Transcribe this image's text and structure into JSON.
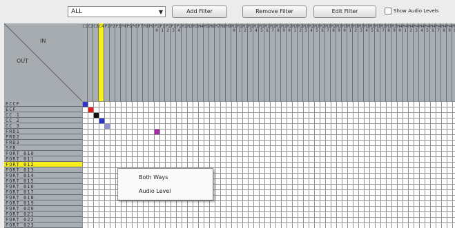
{
  "toolbar": {
    "filter": {
      "selected": "ALL"
    },
    "add_filter": "Add Filter",
    "remove_filter": "Remove Filter",
    "edit_filter": "Edit Filter",
    "show_audio_levels": {
      "label": "Show Audio Levels",
      "checked": false
    }
  },
  "corner": {
    "in_label": "IN",
    "out_label": "OUT"
  },
  "columns": [
    "C1",
    "C2",
    "C3",
    "C4",
    "P1",
    "P2",
    "P3",
    "P4",
    "P5",
    "P6",
    "P7",
    "P8",
    "P9",
    "P10",
    "P11",
    "P12",
    "P13",
    "P14",
    "M1",
    "M2",
    "M3",
    "M4",
    "M5",
    "M6",
    "M7",
    "M8",
    "M9",
    "M10",
    "M11",
    "M12",
    "M13",
    "M14",
    "M15",
    "M16",
    "M17",
    "M18",
    "M19",
    "M20",
    "M21",
    "M22",
    "M23",
    "M24",
    "M25",
    "M26",
    "M27",
    "M28",
    "M29",
    "M30",
    "M31",
    "M32",
    "M33",
    "M34",
    "M35",
    "M36",
    "M37",
    "M38",
    "M39",
    "M40",
    "M41",
    "M42",
    "M43",
    "M44",
    "M45",
    "M46",
    "M47",
    "M48",
    "M49",
    "M50",
    "M51",
    "M52"
  ],
  "selected_column_index": 3,
  "rows": [
    "ECCF",
    "ECF",
    "CC 1",
    "CC 2",
    "CC 3",
    "FRD1",
    "FRD2",
    "FRD3",
    "SFR",
    "FORT_010",
    "FORT_011",
    "FORT_012",
    "FORT_013",
    "FORT_014",
    "FORT_015",
    "FORT_016",
    "FORT_017",
    "FORT_018",
    "FORT_019",
    "FORT_020",
    "FORT_021",
    "FORT_022",
    "FORT_023"
  ],
  "selected_row_index": 11,
  "crosspoints": [
    {
      "row": 0,
      "col": 0,
      "color": "#2b35c9"
    },
    {
      "row": 1,
      "col": 1,
      "color": "#e01d1d"
    },
    {
      "row": 2,
      "col": 2,
      "color": "#111111"
    },
    {
      "row": 3,
      "col": 3,
      "color": "#2b35c9"
    },
    {
      "row": 4,
      "col": 4,
      "color": "#8f93d6"
    },
    {
      "row": 5,
      "col": 13,
      "color": "#a52aa6"
    }
  ],
  "context_menu": {
    "items": [
      "Both Ways",
      "Audio Level"
    ]
  }
}
